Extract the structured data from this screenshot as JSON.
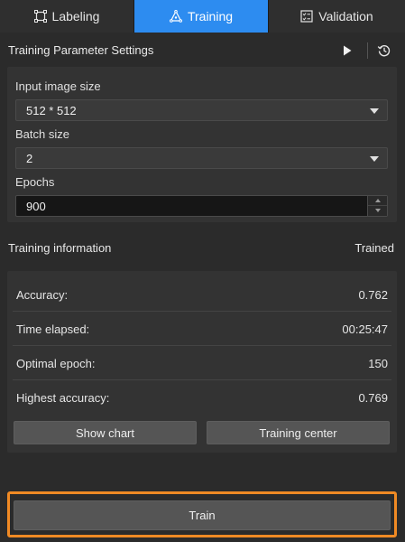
{
  "tabs": [
    {
      "label": "Labeling",
      "icon": "labeling-icon",
      "active": false
    },
    {
      "label": "Training",
      "icon": "training-icon",
      "active": true
    },
    {
      "label": "Validation",
      "icon": "validation-icon",
      "active": false
    }
  ],
  "header": {
    "title": "Training Parameter Settings",
    "play_icon": "play-icon",
    "history_icon": "history-icon"
  },
  "params": {
    "input_size_label": "Input image size",
    "input_size_value": "512 * 512",
    "batch_size_label": "Batch size",
    "batch_size_value": "2",
    "epochs_label": "Epochs",
    "epochs_value": "900"
  },
  "info": {
    "title": "Training information",
    "status": "Trained",
    "rows": [
      {
        "label": "Accuracy:",
        "value": "0.762"
      },
      {
        "label": "Time elapsed:",
        "value": "00:25:47"
      },
      {
        "label": "Optimal epoch:",
        "value": "150"
      },
      {
        "label": "Highest accuracy:",
        "value": "0.769"
      }
    ],
    "show_chart_label": "Show chart",
    "training_center_label": "Training center"
  },
  "train": {
    "label": "Train"
  },
  "colors": {
    "accent": "#2d8cf0",
    "highlight": "#f08a24",
    "background": "#2b2b2b",
    "panel": "#333333"
  }
}
